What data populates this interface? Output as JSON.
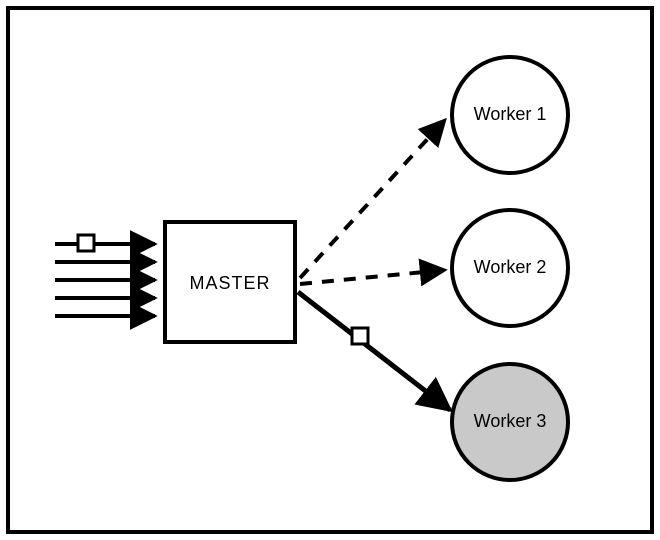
{
  "diagram": {
    "master": {
      "label": "MASTER"
    },
    "workers": [
      {
        "label": "Worker 1",
        "selected": false
      },
      {
        "label": "Worker 2",
        "selected": false
      },
      {
        "label": "Worker 3",
        "selected": true
      }
    ],
    "incoming_requests": 5,
    "packet_on_input_index": 0,
    "assignment": {
      "target_worker_index": 2,
      "packet_visible": true
    },
    "colors": {
      "stroke": "#000000",
      "idle_fill": "#ffffff",
      "busy_fill": "#c9c9c9",
      "packet_fill": "#ffffff"
    }
  }
}
